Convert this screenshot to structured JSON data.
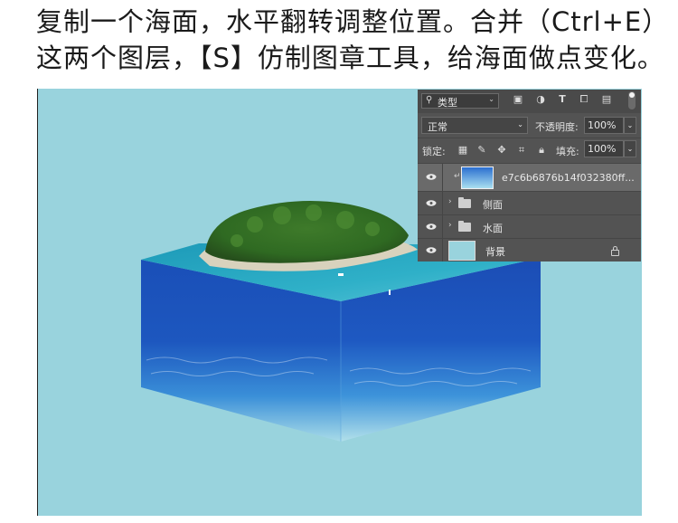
{
  "caption": {
    "line1": "复制一个海面，水平翻转调整位置。合并（Ctrl+E）",
    "line2": "这两个图层，【S】仿制图章工具，给海面做点变化。"
  },
  "canvas": {
    "background": "#99d3dd",
    "artwork": "island-sea-cube"
  },
  "layers_panel": {
    "filter": {
      "kind_label": "类型",
      "icons": [
        "image-filter-icon",
        "adjustment-filter-icon",
        "type-filter-icon",
        "shape-filter-icon",
        "smart-object-filter-icon"
      ]
    },
    "blend_mode": "正常",
    "opacity_label": "不透明度:",
    "opacity_value": "100%",
    "lock_label": "锁定:",
    "fill_label": "填充:",
    "fill_value": "100%",
    "layers": [
      {
        "name": "e7c6b6876b14f032380ff...",
        "type": "clipped-image",
        "selected": true
      },
      {
        "name": "侧面",
        "type": "group"
      },
      {
        "name": "水面",
        "type": "group"
      },
      {
        "name": "背景",
        "type": "background",
        "locked": true
      }
    ]
  }
}
